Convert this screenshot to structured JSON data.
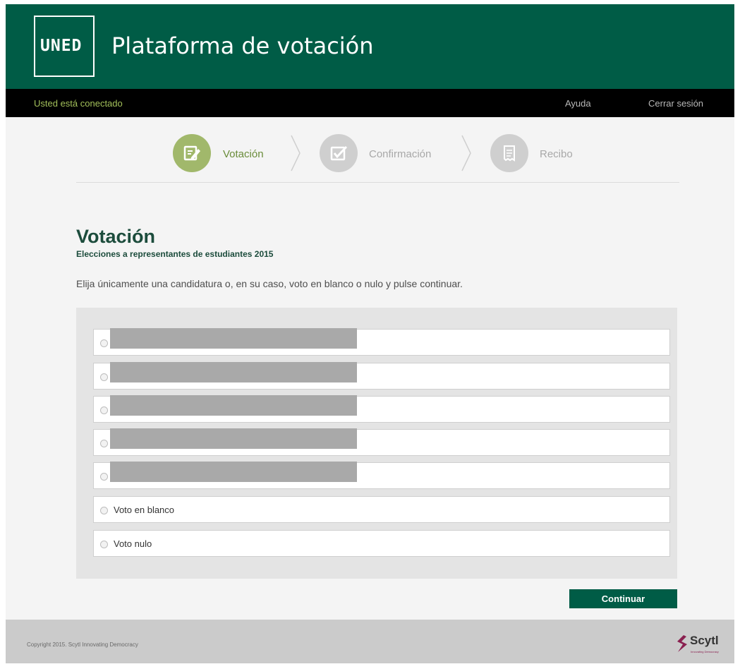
{
  "header": {
    "logo": "UNED",
    "title": "Plataforma de votación"
  },
  "topbar": {
    "status": "Usted está conectado",
    "help": "Ayuda",
    "logout": "Cerrar sesión"
  },
  "steps": [
    {
      "label": "Votación",
      "state": "active",
      "icon": "ballot-edit-icon"
    },
    {
      "label": "Confirmación",
      "state": "inactive",
      "icon": "check-box-icon"
    },
    {
      "label": "Recibo",
      "state": "inactive",
      "icon": "receipt-icon"
    }
  ],
  "main": {
    "title": "Votación",
    "subtitle": "Elecciones a representantes de estudiantes 2015",
    "instructions": "Elija únicamente una candidatura o, en su caso, voto en blanco o nulo y pulse continuar."
  },
  "options": [
    {
      "label": "",
      "redacted": true
    },
    {
      "label": "",
      "redacted": true
    },
    {
      "label": "",
      "redacted": true
    },
    {
      "label": "",
      "redacted": true
    },
    {
      "label": "",
      "redacted": true
    },
    {
      "label": "Voto en blanco",
      "redacted": false
    },
    {
      "label": "Voto nulo",
      "redacted": false
    }
  ],
  "actions": {
    "continue": "Continuar"
  },
  "footer": {
    "copyright": "Copyright 2015. Scytl Innovating Democracy",
    "brand": "Scytl",
    "brand_tagline": "Innovating Democracy"
  },
  "colors": {
    "brand_green": "#005c46",
    "step_active": "#a1b86b",
    "step_inactive": "#cfcfcf",
    "status_green": "#a3c05a",
    "scytl_magenta": "#8a2050"
  }
}
